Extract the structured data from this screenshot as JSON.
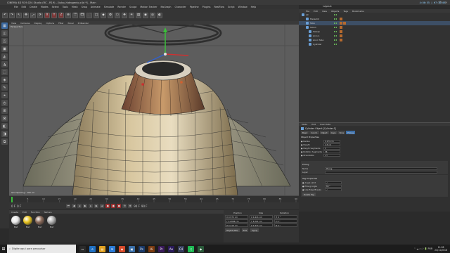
{
  "window": {
    "title": "CINEMA 4D R19.024 Studio (RC - R19) - [tubo_hidrogenio.c4d *] - Main",
    "layout_label": "Layout:",
    "controls": [
      "–",
      "❐",
      "✕"
    ]
  },
  "clock": "4:06:55 | 07:36:08",
  "menu": [
    "File",
    "Edit",
    "Create",
    "Modes",
    "Select",
    "Tools",
    "Mesh",
    "Snap",
    "Animate",
    "Simulate",
    "Render",
    "Sculpt",
    "Motion Tracker",
    "MoGraph",
    "Character",
    "Pipeline",
    "Plugins",
    "RealFlow",
    "Script",
    "Window",
    "Help"
  ],
  "toolbar_icons": [
    "↶",
    "↷",
    "↖",
    "✥",
    "⤢",
    "⟳",
    "X",
    "Y",
    "Z",
    "⊕",
    "🎬",
    "🎞",
    "🎥",
    "□",
    "◆",
    "✿",
    "⬡",
    "❖",
    "☀",
    "▤",
    "◉",
    "◎",
    "◐"
  ],
  "left_tools": [
    "▦",
    "◫",
    "◳",
    "▣",
    "◭",
    "◮",
    "⬚",
    "◈",
    "✎",
    "⌖",
    "◴",
    "⊞",
    "⊠",
    "◧",
    "◨",
    "⧉"
  ],
  "viewport": {
    "menu": [
      "View",
      "Cameras",
      "Display",
      "Options",
      "Filter",
      "Panel",
      "ProRender"
    ],
    "label": "Perspective",
    "grid_spacing": "Grid Spacing : 100 cm",
    "colors": {
      "bg": "#5d5d5d",
      "body": "#c9b28a",
      "wire": "#2a2a2a",
      "torus": "#3a3a3a"
    }
  },
  "timeline": {
    "ticks": [
      "0",
      "5",
      "10",
      "15",
      "20",
      "25",
      "30",
      "35",
      "40",
      "45",
      "50",
      "55",
      "60",
      "65",
      "70",
      "75",
      "80",
      "85",
      "90"
    ],
    "current_frame": "0 F",
    "fields": [
      "0 F",
      "0 F",
      "90 F",
      "90 F"
    ]
  },
  "materials": {
    "menu": [
      "Create",
      "Edit",
      "Function",
      "Texture"
    ],
    "items": [
      {
        "name": "Mat",
        "color": "#e8e8e8"
      },
      {
        "name": "Mat",
        "color": "#e9c420"
      },
      {
        "name": "Mat",
        "color": "#8a6a5a"
      },
      {
        "name": "Mat",
        "color": "#b0b0b0"
      }
    ]
  },
  "coordinates": {
    "headers": [
      "Position",
      "Size",
      "Rotation"
    ],
    "rows": [
      [
        "X  0.572 cm",
        "X  4.221 cm",
        "H  0 °"
      ],
      [
        "Y  51.806 cm",
        "Y  4.221 cm",
        "P  0 °"
      ],
      [
        "Z  0.219 cm",
        "Z  4.221 cm",
        "B  0 °"
      ]
    ],
    "mode": "Object (Rel)",
    "size_mode": "Size",
    "apply": "Apply"
  },
  "object_manager": {
    "menu": [
      "File",
      "Edit",
      "View",
      "Objects",
      "Tags",
      "Bookmarks"
    ],
    "rows": [
      {
        "label": "L0",
        "selected": false,
        "icon": "#6aa0d8"
      },
      {
        "label": "Hexsolid",
        "selected": false,
        "icon": "#6aa0d8"
      },
      {
        "label": "Tubo",
        "selected": true,
        "icon": "#6aa0d8"
      },
      {
        "label": "Tubo1",
        "selected": false,
        "icon": "#6aa0d8"
      },
      {
        "label": "Sweep",
        "selected": false,
        "icon": "#6aa0d8"
      },
      {
        "label": "Arco.1",
        "selected": false,
        "icon": "#6aa0d8"
      },
      {
        "label": "Anco Tubo",
        "selected": false,
        "icon": "#6aa0d8"
      },
      {
        "label": "Cylinder",
        "selected": false,
        "icon": "#6aa0d8"
      }
    ]
  },
  "attributes": {
    "menu": [
      "Mode",
      "Edit",
      "User Data"
    ],
    "title": "Cylinder Object [Cylinder.1]",
    "tabs": [
      "Basic",
      "Coord.",
      "Object",
      "Caps",
      "Slice",
      "Phong"
    ],
    "active_tab": "Phong",
    "section_object": "Object Properties",
    "props": [
      {
        "label": "● Radius",
        "value": "2.174 cm"
      },
      {
        "label": "● Height",
        "value": "4.5 cm"
      },
      {
        "label": "● Height Segments",
        "value": "1"
      },
      {
        "label": "● Rotation Segments",
        "value": "36"
      },
      {
        "label": "● Orientation",
        "value": "+Y"
      }
    ],
    "section_phong": "Phong",
    "tag_props": "Tag Properties",
    "phong_fields": [
      {
        "label": "Name",
        "value": "Phong"
      },
      {
        "label": "Layer",
        "value": ""
      }
    ],
    "tag_fields": [
      {
        "label": "● Angle Limit",
        "value": "✓"
      },
      {
        "label": "● Phong Angle",
        "value": "80 °"
      },
      {
        "label": "● Use Edge Breaks",
        "value": "✓"
      }
    ],
    "delete_button": "Delete Tag"
  },
  "taskbar": {
    "search_placeholder": "Digite aqui para pesquisar",
    "apps": [
      {
        "glyph": "▭",
        "color": "#2a2a2a"
      },
      {
        "glyph": "e",
        "color": "#1f6fc1"
      },
      {
        "glyph": "▤",
        "color": "#e0a020"
      },
      {
        "glyph": "✉",
        "color": "#2a7ad6"
      },
      {
        "glyph": "◉",
        "color": "#d64a2a"
      },
      {
        "glyph": "▣",
        "color": "#3a6fa8"
      },
      {
        "glyph": "Ps",
        "color": "#1a3a6a"
      },
      {
        "glyph": "Ai",
        "color": "#7a3a10"
      },
      {
        "glyph": "Pr",
        "color": "#3a1a5a"
      },
      {
        "glyph": "Ae",
        "color": "#2a1a5a"
      },
      {
        "glyph": "C4",
        "color": "#333a5a"
      },
      {
        "glyph": "♫",
        "color": "#1db954"
      },
      {
        "glyph": "◆",
        "color": "#2a5a3a"
      }
    ],
    "tray_icons": "⌃ ☁ ▭ ♪ 🔋 POR",
    "time": "11:28",
    "date": "24/11/2018"
  }
}
